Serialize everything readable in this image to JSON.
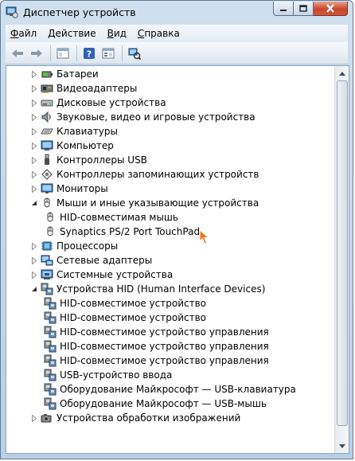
{
  "window": {
    "title": "Диспетчер устройств"
  },
  "menu": [
    {
      "pre": "",
      "ul": "Ф",
      "post": "айл"
    },
    {
      "pre": "",
      "ul": "Д",
      "post": "ействие"
    },
    {
      "pre": "",
      "ul": "В",
      "post": "ид"
    },
    {
      "pre": "",
      "ul": "С",
      "post": "правка"
    }
  ],
  "tree": [
    {
      "label": "Батареи",
      "level": 0,
      "state": "collapsed",
      "icon": "battery-icon"
    },
    {
      "label": "Видеоадаптеры",
      "level": 0,
      "state": "collapsed",
      "icon": "display-adapter-icon"
    },
    {
      "label": "Дисковые устройства",
      "level": 0,
      "state": "collapsed",
      "icon": "disk-drive-icon"
    },
    {
      "label": "Звуковые, видео и игровые устройства",
      "level": 0,
      "state": "collapsed",
      "icon": "speaker-icon"
    },
    {
      "label": "Клавиатуры",
      "level": 0,
      "state": "collapsed",
      "icon": "keyboard-icon"
    },
    {
      "label": "Компьютер",
      "level": 0,
      "state": "collapsed",
      "icon": "computer-icon"
    },
    {
      "label": "Контроллеры USB",
      "level": 0,
      "state": "collapsed",
      "icon": "usb-icon"
    },
    {
      "label": "Контроллеры запоминающих устройств",
      "level": 0,
      "state": "collapsed",
      "icon": "storage-controller-icon"
    },
    {
      "label": "Мониторы",
      "level": 0,
      "state": "collapsed",
      "icon": "monitor-icon"
    },
    {
      "label": "Мыши и иные указывающие устройства",
      "level": 0,
      "state": "expanded",
      "icon": "mouse-icon"
    },
    {
      "label": "HID-совместимая мышь",
      "level": 1,
      "state": "leaf",
      "icon": "mouse-icon"
    },
    {
      "label": "Synaptics PS/2 Port TouchPad",
      "level": 1,
      "state": "leaf",
      "icon": "mouse-icon"
    },
    {
      "label": "Процессоры",
      "level": 0,
      "state": "collapsed",
      "icon": "processor-icon"
    },
    {
      "label": "Сетевые адаптеры",
      "level": 0,
      "state": "collapsed",
      "icon": "network-adapter-icon"
    },
    {
      "label": "Системные устройства",
      "level": 0,
      "state": "collapsed",
      "icon": "system-device-icon"
    },
    {
      "label": "Устройства HID (Human Interface Devices)",
      "level": 0,
      "state": "expanded",
      "icon": "hid-icon"
    },
    {
      "label": "HID-совместимое устройство",
      "level": 1,
      "state": "leaf",
      "icon": "hid-icon"
    },
    {
      "label": "HID-совместимое устройство",
      "level": 1,
      "state": "leaf",
      "icon": "hid-icon"
    },
    {
      "label": "HID-совместимое устройство управления",
      "level": 1,
      "state": "leaf",
      "icon": "hid-icon"
    },
    {
      "label": "HID-совместимое устройство управления",
      "level": 1,
      "state": "leaf",
      "icon": "hid-icon"
    },
    {
      "label": "HID-совместимое устройство управления",
      "level": 1,
      "state": "leaf",
      "icon": "hid-icon"
    },
    {
      "label": "USB-устройство ввода",
      "level": 1,
      "state": "leaf",
      "icon": "hid-icon"
    },
    {
      "label": "Оборудование Майкрософт — USB-клавиатура",
      "level": 1,
      "state": "leaf",
      "icon": "hid-icon"
    },
    {
      "label": "Оборудование Майкрософт — USB-мышь",
      "level": 1,
      "state": "leaf",
      "icon": "hid-icon"
    },
    {
      "label": "Устройства обработки изображений",
      "level": 0,
      "state": "collapsed",
      "icon": "camera-icon"
    }
  ],
  "colors": {
    "title_bar": "#c4d7ea",
    "close_button": "#c7472d",
    "tree_background": "#ffffff"
  }
}
